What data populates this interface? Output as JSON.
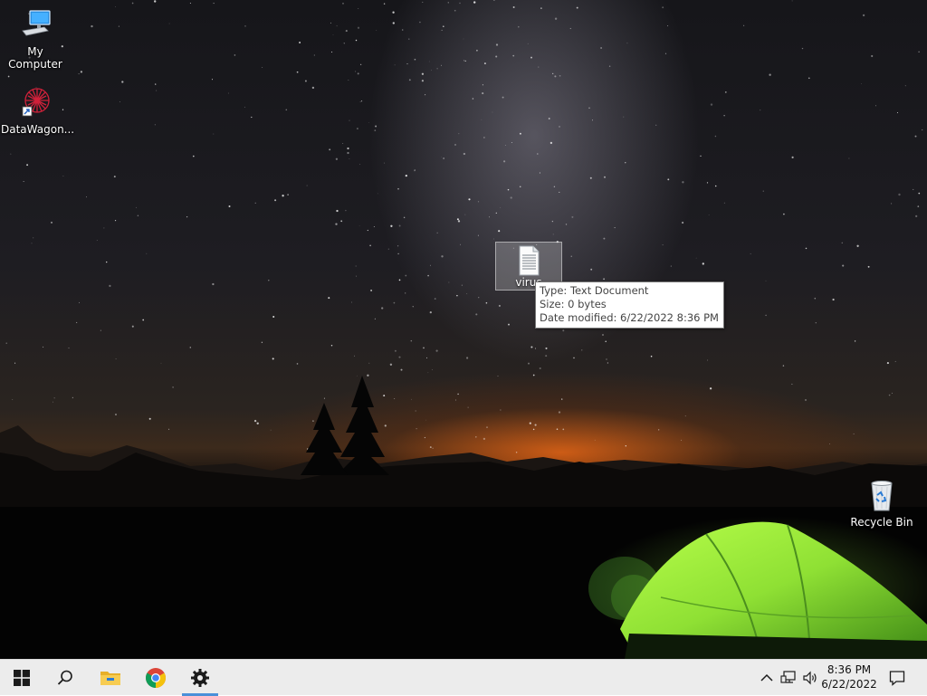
{
  "desktop": {
    "icons": [
      {
        "label": "My Computer",
        "icon": "computer-icon"
      },
      {
        "label": "DataWagon...",
        "icon": "datawagon-shortcut-icon"
      },
      {
        "label": "Recycle Bin",
        "icon": "recycle-bin-icon"
      }
    ],
    "selected_file": {
      "label": "virus",
      "icon": "text-document-icon"
    },
    "tooltip": {
      "type": "Type: Text Document",
      "size": "Size: 0 bytes",
      "modified": "Date modified: 6/22/2022 8:36 PM"
    }
  },
  "taskbar": {
    "buttons": [
      {
        "icon": "windows-start-icon"
      },
      {
        "icon": "search-icon"
      },
      {
        "icon": "file-explorer-icon"
      },
      {
        "icon": "chrome-icon"
      },
      {
        "icon": "settings-gear-icon"
      }
    ],
    "active_button": "settings-gear-icon",
    "tray": [
      {
        "icon": "chevron-up-icon"
      },
      {
        "icon": "network-icon"
      },
      {
        "icon": "volume-icon"
      }
    ],
    "clock": {
      "time": "8:36 PM",
      "date": "6/22/2022"
    },
    "notification_icon": "action-center-icon"
  },
  "colors": {
    "taskbar_bg": "#ececec",
    "active_indicator": "#4a90d9",
    "tent_green": "#8fe034"
  }
}
